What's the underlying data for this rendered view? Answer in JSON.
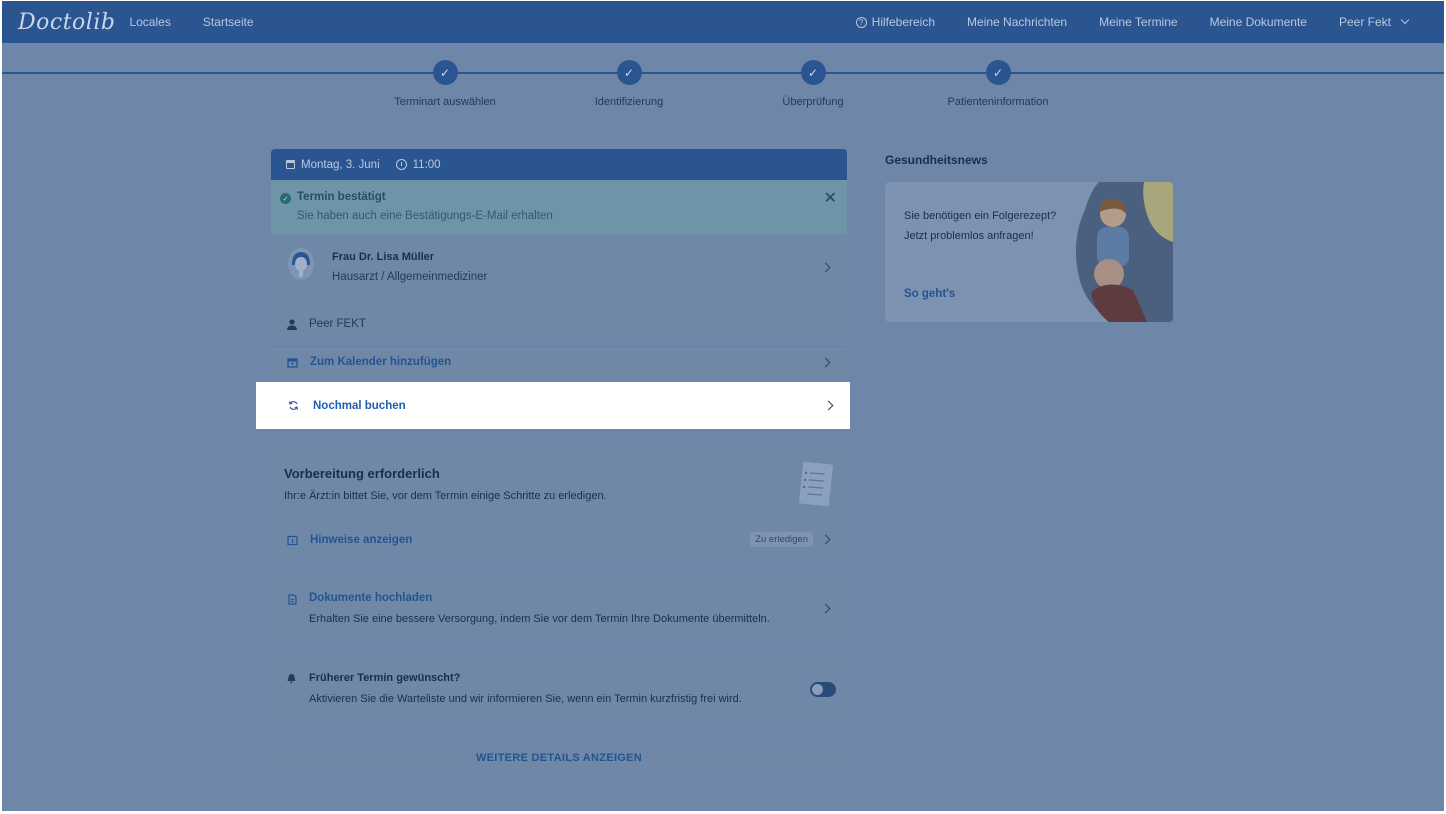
{
  "header": {
    "logo": "Doctolib",
    "nav_left": [
      "Locales",
      "Startseite"
    ],
    "help": "Hilfebereich",
    "messages": "Meine Nachrichten",
    "appointments": "Meine Termine",
    "documents": "Meine Dokumente",
    "user": "Peer Fekt"
  },
  "stepper": {
    "steps": [
      "Terminart auswählen",
      "Identifizierung",
      "Überprüfung",
      "Patienteninformation"
    ]
  },
  "appointment": {
    "date": "Montag, 3. Juni",
    "time": "11:00",
    "confirm_title": "Termin bestätigt",
    "confirm_sub": "Sie haben auch eine Bestätigungs-E-Mail erhalten",
    "doctor_name": "Frau Dr. Lisa Müller",
    "doctor_specialty": "Hausarzt / Allgemeinmediziner",
    "patient": "Peer FEKT",
    "add_calendar": "Zum Kalender hinzufügen",
    "book_again": "Nochmal buchen"
  },
  "preparation": {
    "title": "Vorbereitung erforderlich",
    "subtitle": "Ihr:e Ärzt:in bittet Sie, vor dem Termin einige Schritte zu erledigen.",
    "hints": "Hinweise anzeigen",
    "badge": "Zu erledigen"
  },
  "documents_card": {
    "title": "Dokumente hochladen",
    "desc": "Erhalten Sie eine bessere Versorgung, indem Sie vor dem Termin Ihre Dokumente übermitteln."
  },
  "waitlist": {
    "title": "Früherer Termin gewünscht?",
    "desc": "Aktivieren Sie die Warteliste und wir informieren Sie, wenn ein Termin kurzfristig frei wird."
  },
  "more_details": "WEITERE DETAILS ANZEIGEN",
  "news": {
    "title": "Gesundheitsnews",
    "line1": "Sie benötigen ein Folgerezept?",
    "line2": "Jetzt problemlos anfragen!",
    "link": "So geht's"
  }
}
